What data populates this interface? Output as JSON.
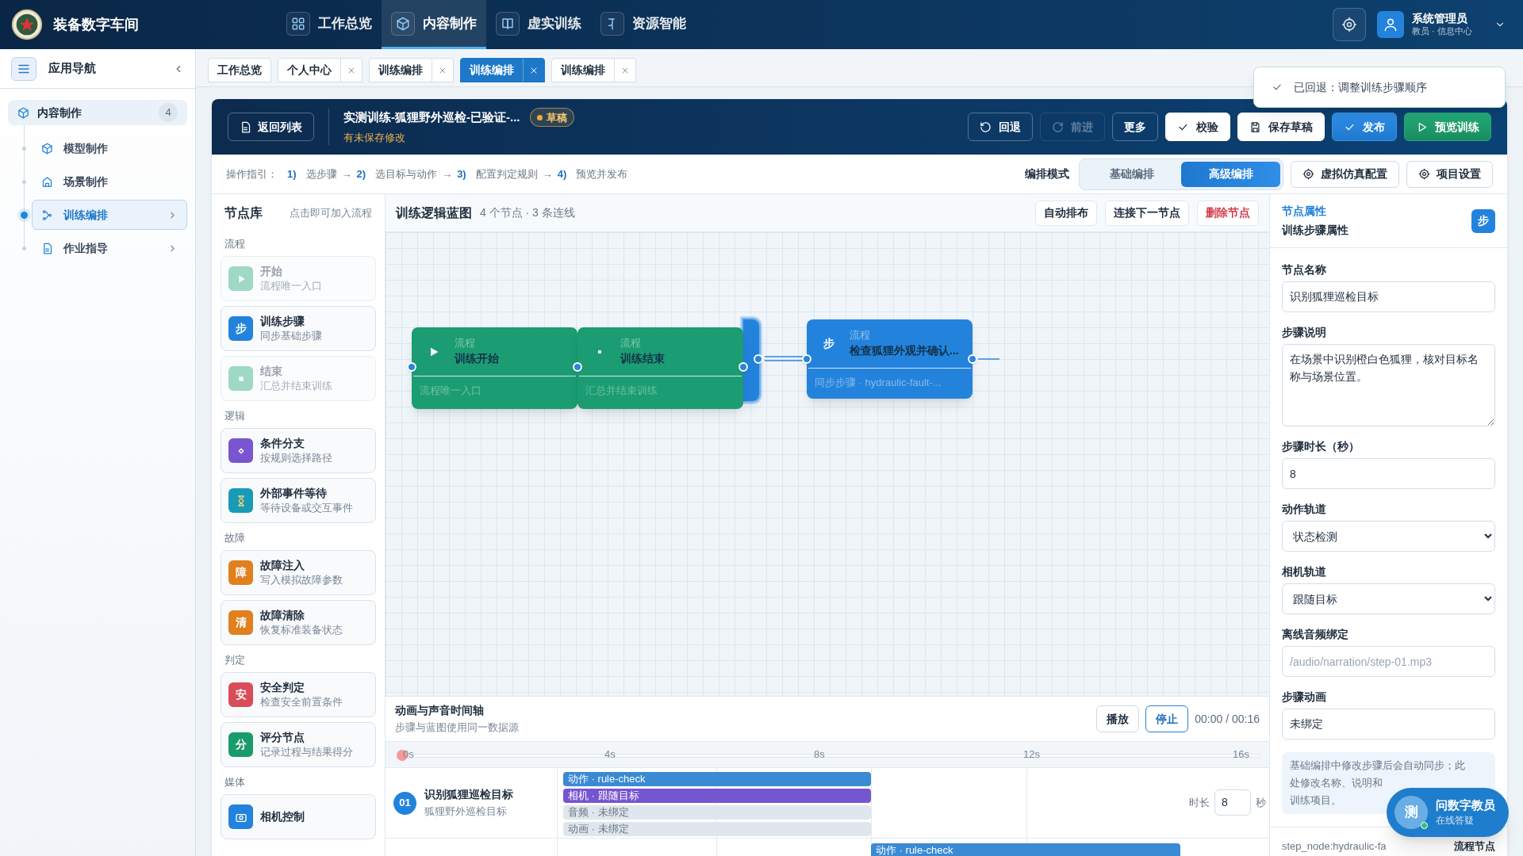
{
  "app": {
    "title": "装备数字车间"
  },
  "nav": [
    {
      "label": "工作总览",
      "selected": false
    },
    {
      "label": "内容制作",
      "selected": true
    },
    {
      "label": "虚实训练",
      "selected": false
    },
    {
      "label": "资源智能",
      "selected": false
    }
  ],
  "user": {
    "name": "系统管理员",
    "role": "教员 · 信息中心"
  },
  "sidebar": {
    "title": "应用导航",
    "items": [
      {
        "label": "内容制作",
        "count": "4",
        "selected": false,
        "children": [
          {
            "label": "模型制作",
            "selected": false
          },
          {
            "label": "场景制作",
            "selected": false
          },
          {
            "label": "训练编排",
            "selected": true,
            "expanded": false
          },
          {
            "label": "作业指导",
            "selected": false,
            "expanded": false
          }
        ]
      }
    ]
  },
  "tabs": [
    {
      "label": "工作总览",
      "closable": false,
      "selected": false
    },
    {
      "label": "个人中心",
      "closable": true,
      "selected": false
    },
    {
      "label": "训练编排",
      "closable": true,
      "selected": false
    },
    {
      "label": "训练编排",
      "closable": true,
      "selected": true
    },
    {
      "label": "训练编排",
      "closable": true,
      "selected": false
    }
  ],
  "toast": {
    "text": "已回退：调整训练步骤顺序"
  },
  "editor": {
    "back": "返回列表",
    "title": "实测训练-狐狸野外巡检-已验证-...",
    "status": "草稿",
    "note": "有未保存修改",
    "actions": [
      {
        "label": "回退",
        "kind": "dark",
        "disabled": false
      },
      {
        "label": "前进",
        "kind": "dark",
        "disabled": true
      },
      {
        "label": "更多",
        "kind": "dark",
        "disabled": false
      },
      {
        "label": "校验",
        "kind": "light",
        "disabled": false
      },
      {
        "label": "保存草稿",
        "kind": "light",
        "disabled": false
      },
      {
        "label": "发布",
        "kind": "primary",
        "disabled": false
      },
      {
        "label": "预览训练",
        "kind": "success",
        "disabled": false
      }
    ]
  },
  "guide": {
    "label": "操作指引：",
    "steps": [
      {
        "num": "1)",
        "label": "选步骤"
      },
      {
        "arrow": "→",
        "num": "2)",
        "label": "选目标与动作"
      },
      {
        "arrow": "→",
        "num": "3)",
        "label": "配置判定规则"
      },
      {
        "arrow": "→",
        "num": "4)",
        "label": "预览并发布"
      }
    ]
  },
  "mode": {
    "label": "编排模式",
    "options": [
      {
        "label": "基础编排",
        "selected": false
      },
      {
        "label": "高级编排",
        "selected": true
      }
    ],
    "buttons": [
      "虚拟仿真配置",
      "项目设置"
    ]
  },
  "node_library": {
    "title": "节点库",
    "hint": "点击即可加入流程",
    "groups": [
      {
        "label": "流程",
        "items": [
          {
            "kind": "start",
            "title": "开始",
            "desc": "流程唯一入口",
            "color": "#9fd8c3",
            "disabled": true
          },
          {
            "kind": "text",
            "glyph": "步",
            "title": "训练步骤",
            "desc": "同步基础步骤",
            "color": "#2383dc",
            "disabled": false
          },
          {
            "kind": "end",
            "title": "结束",
            "desc": "汇总并结束训练",
            "color": "#9fd8c3",
            "disabled": true
          }
        ]
      },
      {
        "label": "逻辑",
        "items": [
          {
            "kind": "branch",
            "title": "条件分支",
            "desc": "按规则选择路径",
            "color": "#7a55d0",
            "disabled": false
          },
          {
            "kind": "wait",
            "title": "外部事件等待",
            "desc": "等待设备或交互事件",
            "color": "#1a9bb5",
            "disabled": false
          }
        ]
      },
      {
        "label": "故障",
        "items": [
          {
            "kind": "text",
            "glyph": "障",
            "title": "故障注入",
            "desc": "写入模拟故障参数",
            "color": "#e0801e",
            "disabled": false
          },
          {
            "kind": "text",
            "glyph": "清",
            "title": "故障清除",
            "desc": "恢复标准装备状态",
            "color": "#e0801e",
            "disabled": false
          }
        ]
      },
      {
        "label": "判定",
        "items": [
          {
            "kind": "text",
            "glyph": "安",
            "title": "安全判定",
            "desc": "检查安全前置条件",
            "color": "#d94c5a",
            "disabled": false
          },
          {
            "kind": "text",
            "glyph": "分",
            "title": "评分节点",
            "desc": "记录过程与结果得分",
            "color": "#1a9b6c",
            "disabled": false
          }
        ]
      },
      {
        "label": "媒体",
        "items": [
          {
            "kind": "camera",
            "title": "相机控制",
            "color": "#2383dc",
            "disabled": false
          }
        ]
      }
    ]
  },
  "canvas": {
    "title": "训练逻辑蓝图",
    "meta": "4 个节点 · 3 条连线",
    "buttons": [
      {
        "label": "自动排布",
        "kind": "default"
      },
      {
        "label": "连接下一节点",
        "kind": "default"
      },
      {
        "label": "删除节点",
        "kind": "danger"
      }
    ],
    "nodes": [
      {
        "kind": "step",
        "selected": true
      },
      {
        "kind": "start",
        "category": "流程",
        "title": "训练开始",
        "subtitle": "流程唯一入口",
        "selected": false
      },
      {
        "kind": "end",
        "category": "流程",
        "title": "训练结束",
        "subtitle": "汇总并结束训练",
        "selected": false
      },
      {
        "kind": "step",
        "glyph": "步",
        "category": "流程",
        "title": "检查狐狸外观并确认...",
        "subtitle": "同步步骤 · hydraulic-fault-...",
        "selected": false
      }
    ]
  },
  "timeline": {
    "title": "动画与声音时间轴",
    "subtitle": "步骤与蓝图使用同一数据源",
    "buttons": [
      {
        "label": "播放",
        "selected": false
      },
      {
        "label": "停止",
        "selected": true
      }
    ],
    "time": "00:00 / 00:16",
    "ticks": [
      "0s",
      "4s",
      "8s",
      "12s",
      "16s"
    ],
    "rows": [
      {
        "num": "01",
        "title": "识别狐狸巡检目标",
        "subtitle": "狐狸野外巡检目标",
        "duration_label": "时长",
        "duration": "8",
        "unit": "秒",
        "tracks": [
          {
            "kind": "action",
            "label": "动作 · rule-check"
          },
          {
            "kind": "camera",
            "label": "相机 · 跟随目标"
          },
          {
            "kind": "audio",
            "label": "音频 · 未绑定"
          },
          {
            "kind": "animation",
            "label": "动画 · 未绑定"
          }
        ]
      },
      {
        "tracks": [
          {
            "kind": "action",
            "label": "动作 · rule-check"
          }
        ]
      }
    ]
  },
  "properties": {
    "label": "节点属性",
    "title": "训练步骤属性",
    "glyph": "步",
    "fields": [
      {
        "label": "节点名称",
        "kind": "input",
        "value": "识别狐狸巡检目标"
      },
      {
        "label": "步骤说明",
        "kind": "textarea",
        "value": "在场景中识别橙白色狐狸，核对目标名称与场景位置。"
      },
      {
        "label": "步骤时长（秒）",
        "kind": "input",
        "value": "8"
      },
      {
        "label": "动作轨道",
        "kind": "select",
        "value": "状态检测"
      },
      {
        "label": "相机轨道",
        "kind": "select",
        "value": "跟随目标"
      },
      {
        "label": "离线音频绑定",
        "kind": "input",
        "placeholder": "/audio/narration/step-01.mp3"
      },
      {
        "label": "步骤动画",
        "kind": "input",
        "value": "未绑定"
      }
    ],
    "note": "基础编排中修改步骤后会自动同步；此处修改名称、说明和",
    "note_end": "训练项目。",
    "footer_id": "step_node:hydraulic-fa",
    "footer_type": "流程节点"
  },
  "assistant": {
    "avatar": "测",
    "title": "问数字教员",
    "subtitle": "在线答疑",
    "online": true
  }
}
